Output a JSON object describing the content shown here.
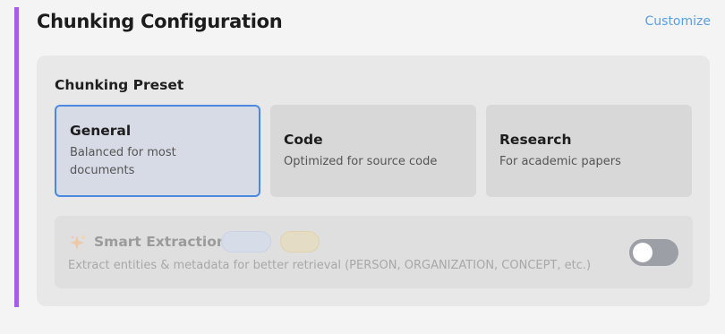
{
  "header": {
    "title": "Chunking Configuration",
    "customize_label": "Customize"
  },
  "preset": {
    "heading": "Chunking Preset",
    "options": [
      {
        "name": "General",
        "description": "Balanced for most documents",
        "selected": true
      },
      {
        "name": "Code",
        "description": "Optimized for source code",
        "selected": false
      },
      {
        "name": "Research",
        "description": "For academic papers",
        "selected": false
      }
    ]
  },
  "smart_extraction": {
    "icon": "sparkle-icon",
    "title": "Smart Extraction",
    "badge_blue": "",
    "badge_yellow": "",
    "description": "Extract entities & metadata for better retrieval (PERSON, ORGANIZATION, CONCEPT, etc.)",
    "enabled": false
  },
  "colors": {
    "accent_bar": "#a35ee6",
    "link": "#5a9fde",
    "selected_border": "#4a88e2",
    "toggle_off": "#9c9fa6"
  }
}
